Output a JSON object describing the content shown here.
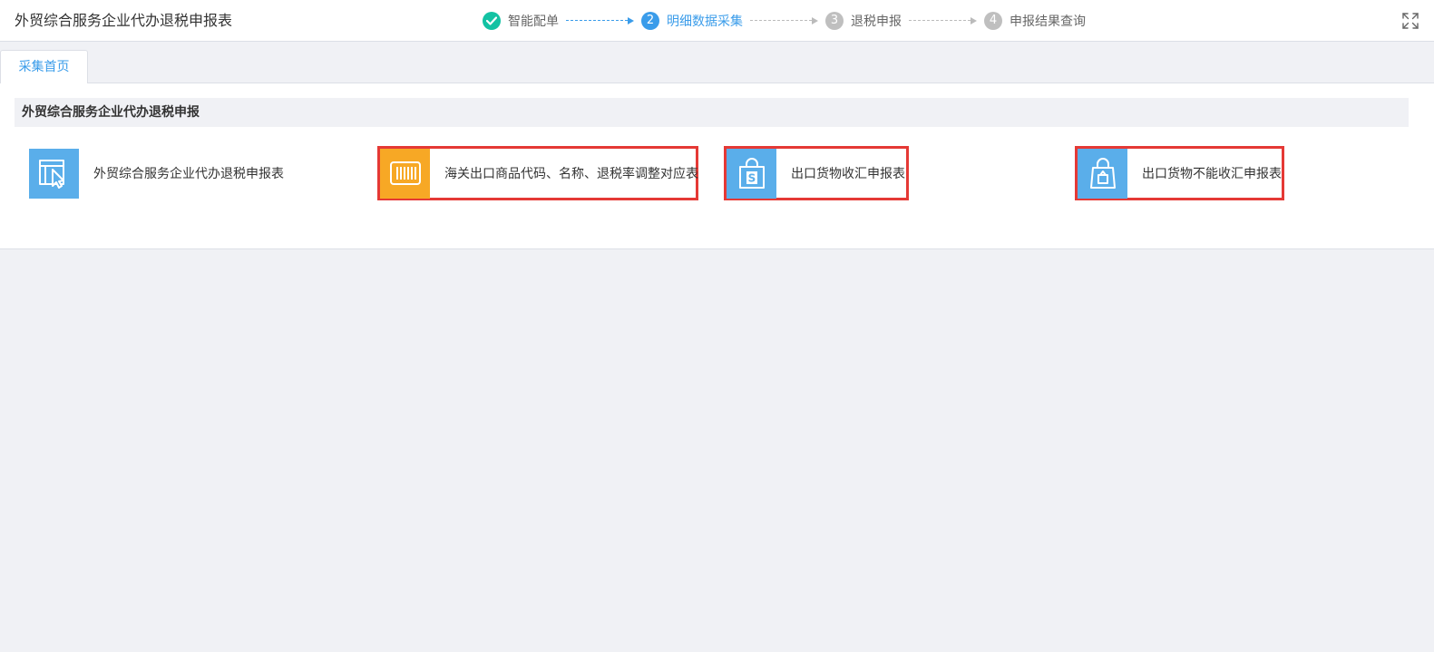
{
  "header": {
    "title": "外贸综合服务企业代办退税申报表",
    "steps": [
      {
        "number": "",
        "label": "智能配单",
        "status": "done"
      },
      {
        "number": "2",
        "label": "明细数据采集",
        "status": "active"
      },
      {
        "number": "3",
        "label": "退税申报",
        "status": "todo"
      },
      {
        "number": "4",
        "label": "申报结果查询",
        "status": "todo"
      }
    ],
    "fullscreen_icon": "expand-icon"
  },
  "tabs": [
    {
      "label": "采集首页",
      "active": true
    }
  ],
  "section": {
    "title": "外贸综合服务企业代办退税申报"
  },
  "cards": [
    {
      "label": "外贸综合服务企业代办退税申报表",
      "icon": "pointer-window-icon",
      "color": "#5aaeea",
      "highlighted": false
    },
    {
      "label": "海关出口商品代码、名称、退税率调整对应表",
      "icon": "barcode-icon",
      "color": "#f7a825",
      "highlighted": true
    },
    {
      "label": "出口货物收汇申报表",
      "icon": "dollar-bag-icon",
      "color": "#5aaeea",
      "highlighted": true
    },
    {
      "label": "出口货物不能收汇申报表",
      "icon": "lock-bag-icon",
      "color": "#5aaeea",
      "highlighted": true
    }
  ],
  "colors": {
    "accent": "#3a9cea",
    "done": "#13c2a3",
    "todo": "#bfbfbf",
    "highlight_border": "#e53935"
  }
}
